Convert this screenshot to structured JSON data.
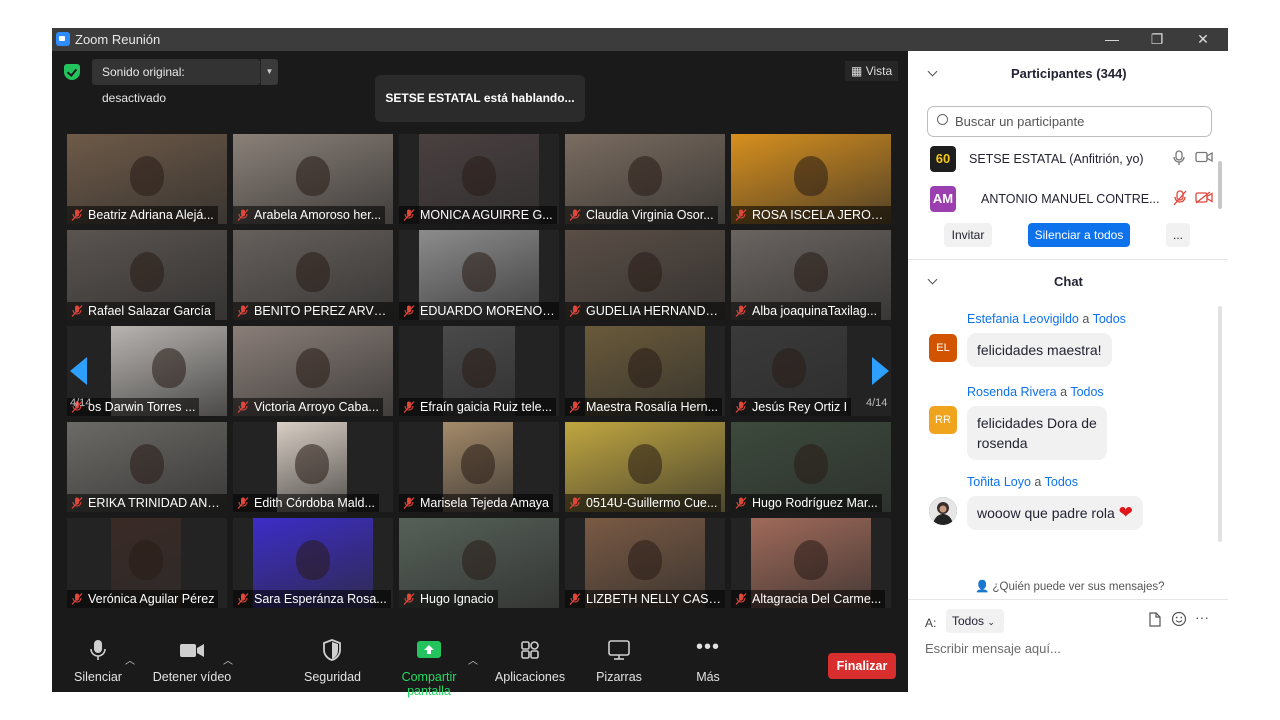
{
  "window": {
    "title": "Zoom Reunión",
    "controls": [
      "—",
      "❐",
      "✕"
    ]
  },
  "meeting": {
    "sound_label": "Sonido original: desactivado",
    "speaking_text": "SETSE ESTATAL está hablando...",
    "view_label": "Vista",
    "page_indicator": "4/14"
  },
  "tiles": [
    {
      "name": "Beatriz Adriana Alejá...",
      "bg": "#6e5a48"
    },
    {
      "name": "Arabela Amoroso her...",
      "bg": "#8a8078"
    },
    {
      "name": "MONICA AGUIRRE G...",
      "bg": "#4a4040"
    },
    {
      "name": "Claudia Virginia Osor...",
      "bg": "#7a6c60"
    },
    {
      "name": "ROSA ISCELA JERONI...",
      "bg": "#d7901e"
    },
    {
      "name": "Rafael Salazar García",
      "bg": "#5a5450"
    },
    {
      "name": "BENITO PEREZ ARVIZU",
      "bg": "#66605c"
    },
    {
      "name": "EDUARDO MORENO ...",
      "bg": "#8c8c8c"
    },
    {
      "name": "GUDELIA HERNANDE...",
      "bg": "#5a4e46"
    },
    {
      "name": "Alba joaquinaTaxilag...",
      "bg": "#6a6460"
    },
    {
      "name": "os Darwin Torres ...",
      "bg": "#b8b4b0"
    },
    {
      "name": "Victoria Arroyo Caba...",
      "bg": "#8a7e78"
    },
    {
      "name": "Efraín gaicia Ruiz tele...",
      "bg": "#4a4a4a"
    },
    {
      "name": "Maestra Rosalía Hern...",
      "bg": "#6a5a3a"
    },
    {
      "name": "Jesús Rey Ortiz I",
      "bg": "#3a3a3a"
    },
    {
      "name": "ERIKA TRINIDAD AND...",
      "bg": "#6c6a66"
    },
    {
      "name": "Edith Córdoba Mald...",
      "bg": "#d8cec4"
    },
    {
      "name": "Marisela Tejeda Amaya",
      "bg": "#a48a6a"
    },
    {
      "name": "0514U-Guillermo Cue...",
      "bg": "#c0a640"
    },
    {
      "name": "Hugo Rodríguez Mar...",
      "bg": "#3c4a3c"
    },
    {
      "name": "Verónica Aguilar Pérez",
      "bg": "#3a2a26"
    },
    {
      "name": "Sara Esperánza Rosa...",
      "bg": "#3d2cc8"
    },
    {
      "name": "Hugo Ignacio",
      "bg": "#566058"
    },
    {
      "name": "LIZBETH NELLY CASTI...",
      "bg": "#7a5a44"
    },
    {
      "name": "Altagracia Del Carme...",
      "bg": "#a06a5a"
    }
  ],
  "toolbar": {
    "mute": "Silenciar",
    "video": "Detener vídeo",
    "security": "Seguridad",
    "share": "Compartir pantalla",
    "apps": "Aplicaciones",
    "whiteboards": "Pizarras",
    "more": "Más",
    "end": "Finalizar"
  },
  "participants": {
    "title": "Participantes (344)",
    "search_placeholder": "Buscar un participante",
    "list": [
      {
        "avatar": "60",
        "name": "SETSE ESTATAL (Anfitrión, yo)",
        "avatar_color": "#1e1e1e"
      },
      {
        "avatar": "AM",
        "name": "ANTONIO MANUEL CONTRE...",
        "avatar_color": "#9b3fb0"
      }
    ],
    "invite": "Invitar",
    "mute_all": "Silenciar a todos",
    "more": "..."
  },
  "chat": {
    "title": "Chat",
    "to_word": "a",
    "messages": [
      {
        "sender": "Estefania Leovigildo",
        "to": "Todos",
        "initials": "EL",
        "color": "#d35400",
        "text": "felicidades maestra!"
      },
      {
        "sender": "Rosenda Rivera",
        "to": "Todos",
        "initials": "RR",
        "color": "#f0a41e",
        "text_line1": "felicidades Dora de",
        "text_line2": "rosenda"
      },
      {
        "sender": "Toñita Loyo",
        "to": "Todos",
        "initials": "",
        "color": "#444444",
        "text": "wooow que padre rola",
        "emoji": "❤"
      }
    ],
    "who_can_see": "¿Quién puede ver sus mensajes?",
    "to_label": "A:",
    "to_value": "Todos",
    "compose_placeholder": "Escribir mensaje aquí..."
  }
}
